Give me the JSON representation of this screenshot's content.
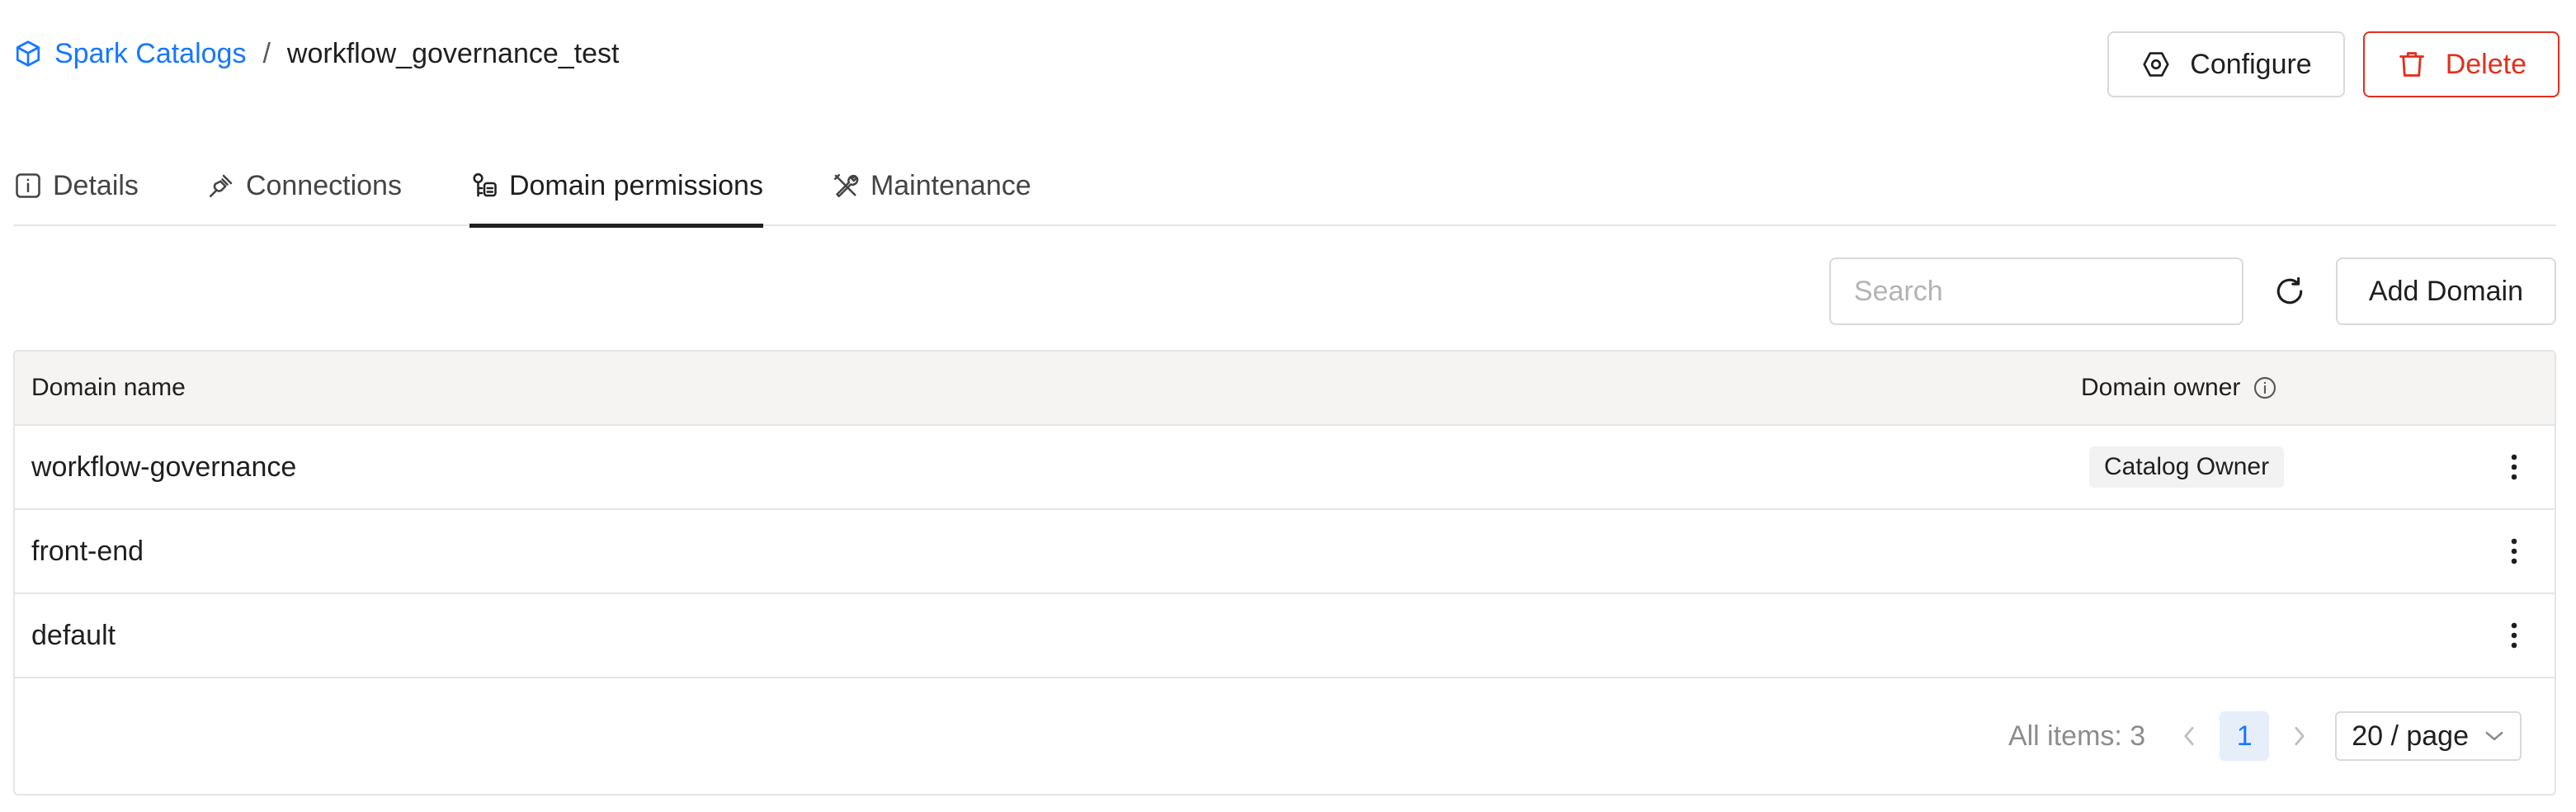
{
  "breadcrumb": {
    "parent": "Spark Catalogs",
    "separator": "/",
    "current": "workflow_governance_test"
  },
  "actions": {
    "configure": "Configure",
    "delete": "Delete"
  },
  "tabs": [
    {
      "label": "Details",
      "icon": "info-icon",
      "active": false
    },
    {
      "label": "Connections",
      "icon": "plug-icon",
      "active": false
    },
    {
      "label": "Domain permissions",
      "icon": "domain-permissions-icon",
      "active": true
    },
    {
      "label": "Maintenance",
      "icon": "tools-icon",
      "active": false
    }
  ],
  "toolbar": {
    "search_placeholder": "Search",
    "search_value": "",
    "add_domain": "Add Domain"
  },
  "table": {
    "columns": [
      "Domain name",
      "Domain owner"
    ],
    "rows": [
      {
        "name": "workflow-governance",
        "owner": "Catalog Owner"
      },
      {
        "name": "front-end",
        "owner": ""
      },
      {
        "name": "default",
        "owner": ""
      }
    ]
  },
  "pagination": {
    "total_text": "All items: 3",
    "current_page": "1",
    "page_size": "20 / page"
  },
  "colors": {
    "link": "#1677ff",
    "danger": "#e0301e",
    "header_bg": "#f5f4f2"
  }
}
